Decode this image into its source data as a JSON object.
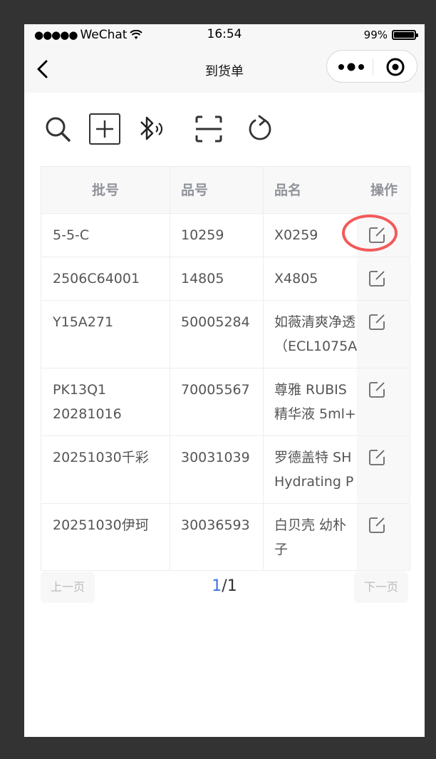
{
  "status_bar": {
    "signal_dots": "●●●●●",
    "carrier": "WeChat",
    "time": "16:54",
    "battery_text": "99%",
    "battery_level": 0.99
  },
  "nav": {
    "title": "到货单",
    "back_icon": "chevron-left-icon",
    "more_icon": "more-dots-icon",
    "close_icon": "target-close-icon"
  },
  "toolbar": {
    "icons": [
      "search-icon",
      "add-box-icon",
      "bluetooth-icon",
      "scan-icon",
      "refresh-icon"
    ]
  },
  "table": {
    "headers": [
      "批号",
      "品号",
      "品名",
      "操作"
    ],
    "rows": [
      {
        "batch": [
          "5-5-C"
        ],
        "code": "10259",
        "name": [
          "X0259"
        ]
      },
      {
        "batch": [
          "2506C64001"
        ],
        "code": "14805",
        "name": [
          "X4805"
        ]
      },
      {
        "batch": [
          "Y15A271"
        ],
        "code": "50005284",
        "name": [
          "如薇清爽净透",
          "（ECL1075A"
        ]
      },
      {
        "batch": [
          "PK13Q1",
          "20281016"
        ],
        "code": "70005567",
        "name": [
          "尊雅 RUBIS",
          "精华液 5ml+"
        ]
      },
      {
        "batch": [
          "20251030千彩"
        ],
        "code": "30031039",
        "name": [
          "罗德盖特 SH",
          "Hydrating P"
        ]
      },
      {
        "batch": [
          "20251030伊珂"
        ],
        "code": "30036593",
        "name": [
          "白贝壳 幼朴",
          "子"
        ]
      }
    ],
    "action_icon": "edit-icon"
  },
  "pagination": {
    "prev_label": "上一页",
    "next_label": "下一页",
    "current": "1",
    "separator": "/",
    "total": "1"
  },
  "colors": {
    "accent": "#3874e0",
    "highlight": "#f25a5a",
    "header_text": "#909399"
  }
}
